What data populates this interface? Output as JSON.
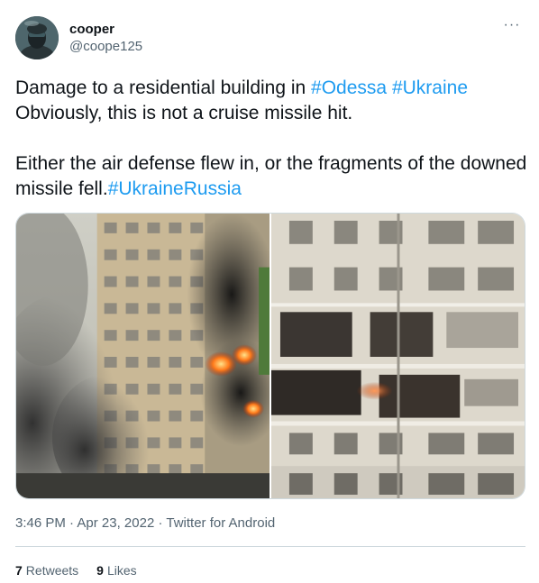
{
  "user": {
    "display_name": "cooper",
    "handle": "@coope125",
    "avatar_icon": "soldier-avatar",
    "more_icon": "more-dots-icon",
    "more_glyph": "···"
  },
  "tweet": {
    "text_1": "Damage to a residential building in ",
    "hashtag_odessa": "#Odessa",
    "space": " ",
    "hashtag_ukraine": "#Ukraine",
    "text_2": "\nObviously, this is not a cruise missile hit.\n\nEither the air defense flew in, or the fragments of the downed missile fell.",
    "hashtag_ukrainerussia": "#UkraineRussia",
    "hashtag_color": "#1d9bf0"
  },
  "media": {
    "photo_left": "burning-building-photo",
    "photo_right": "damaged-building-photo"
  },
  "meta": {
    "time": "3:46 PM",
    "sep1": " · ",
    "date": "Apr 23, 2022",
    "sep2": " · ",
    "source": "Twitter for Android"
  },
  "stats": {
    "retweets_count": "7",
    "retweets_label": "Retweets",
    "likes_count": "9",
    "likes_label": "Likes"
  }
}
